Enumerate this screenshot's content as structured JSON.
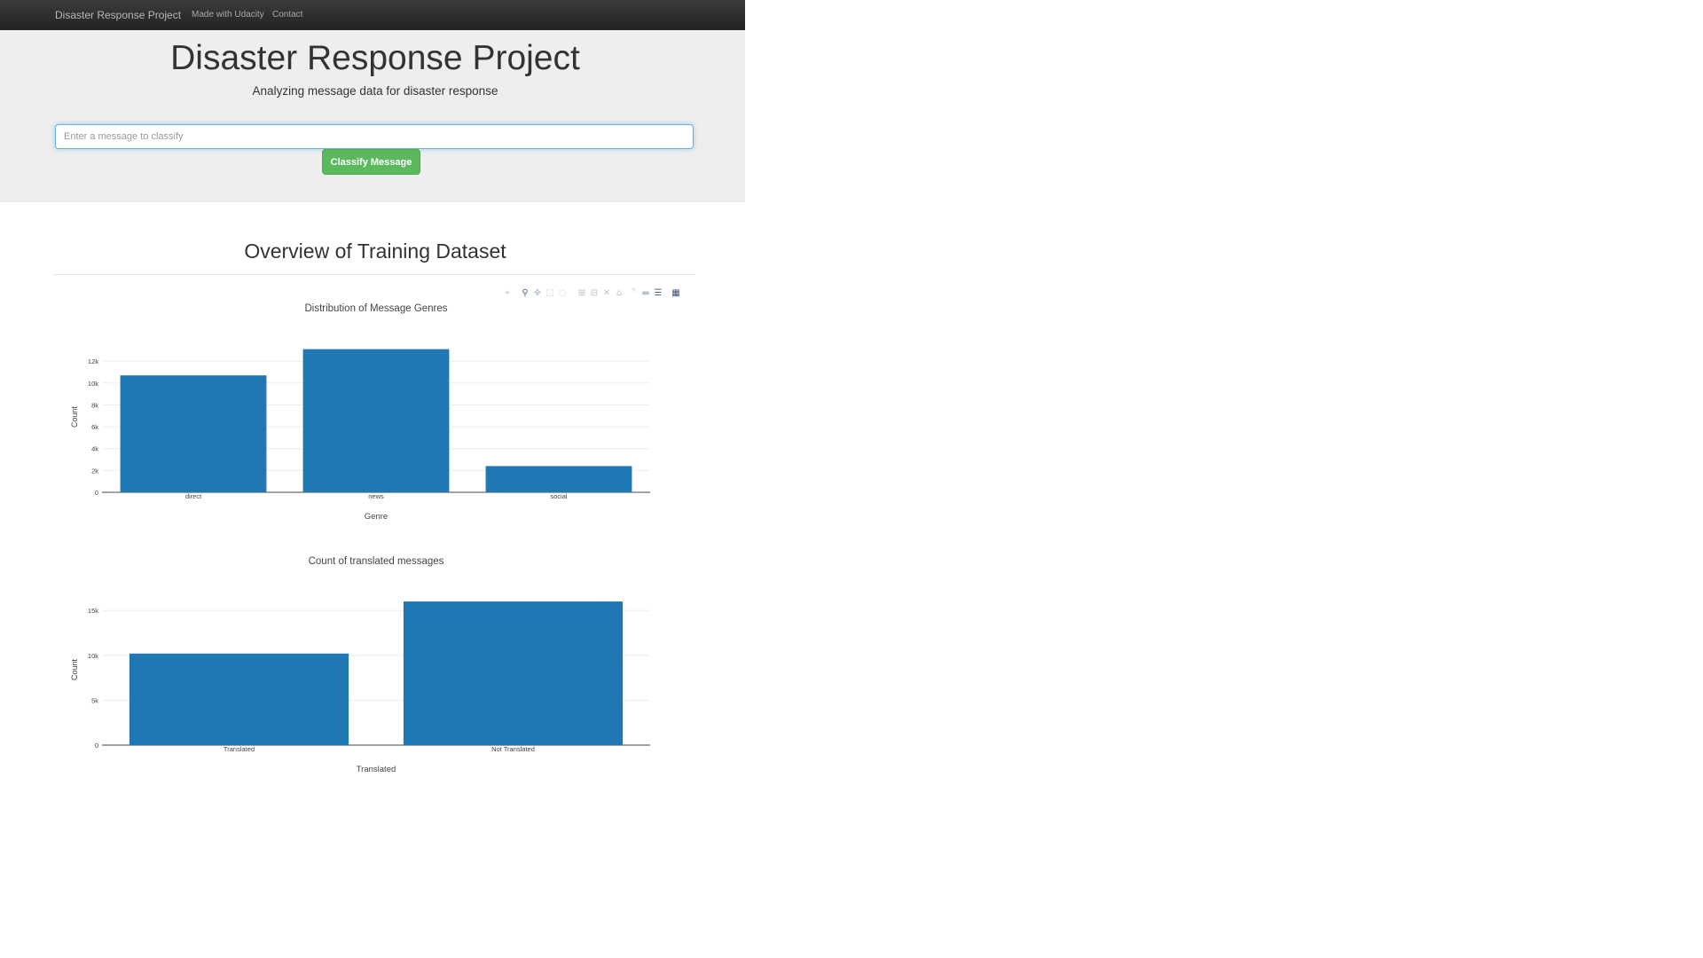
{
  "navbar": {
    "brand": "Disaster Response Project",
    "links": [
      "Made with Udacity",
      "Contact"
    ],
    "background": "#222222"
  },
  "header": {
    "title": "Disaster Response Project",
    "subtitle": "Analyzing message data for disaster response"
  },
  "search": {
    "placeholder": "Enter a message to classify",
    "value": ""
  },
  "classify_button": {
    "label": "Classify Message",
    "color": "#5cb85c"
  },
  "section": {
    "title": "Overview of Training Dataset"
  },
  "modebar": {
    "icons": [
      "camera-icon",
      "zoom-icon",
      "pan-icon",
      "box-select-icon",
      "lasso-select-icon",
      "zoom-in-icon",
      "zoom-out-icon",
      "autoscale-icon",
      "reset-axes-icon",
      "spike-lines-icon",
      "hover-closest-icon",
      "hover-compare-icon",
      "plotly-logo-icon"
    ]
  },
  "bar_color": "#1f77b4",
  "chart_data": [
    {
      "type": "bar",
      "title": "Distribution of Message Genres",
      "xlabel": "Genre",
      "ylabel": "Count",
      "categories": [
        "direct",
        "news",
        "social"
      ],
      "values": [
        10700,
        13100,
        2400
      ],
      "ylim": [
        0,
        13800
      ],
      "yticks": [
        0,
        2000,
        4000,
        6000,
        8000,
        10000,
        12000
      ],
      "ytick_labels": [
        "0",
        "2k",
        "4k",
        "6k",
        "8k",
        "10k",
        "12k"
      ],
      "grid": true
    },
    {
      "type": "bar",
      "title": "Count of translated messages",
      "xlabel": "Translated",
      "ylabel": "Count",
      "categories": [
        "Translated",
        "Not Translated"
      ],
      "values": [
        10200,
        16000
      ],
      "ylim": [
        0,
        16800
      ],
      "yticks": [
        0,
        5000,
        10000,
        15000
      ],
      "ytick_labels": [
        "0",
        "5k",
        "10k",
        "15k"
      ],
      "grid": true
    }
  ]
}
